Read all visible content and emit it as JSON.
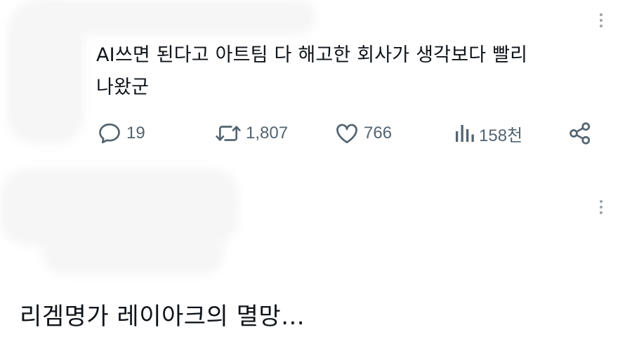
{
  "tweet": {
    "text_line1": "AI쓰면 된다고 아트팀 다 해고한 회사가 생각보다 빨리",
    "text_line2": "나왔군",
    "replies": "19",
    "retweets": "1,807",
    "likes": "766",
    "views": "158천"
  },
  "reply": {
    "text": "리겜명가 레이아크의 멸망..."
  },
  "colors": {
    "text": "#0f1419",
    "muted": "#536471",
    "dots": "#9aa1a8"
  },
  "icons": [
    "more-icon",
    "reply-icon",
    "retweet-icon",
    "like-icon",
    "views-icon",
    "share-icon"
  ]
}
